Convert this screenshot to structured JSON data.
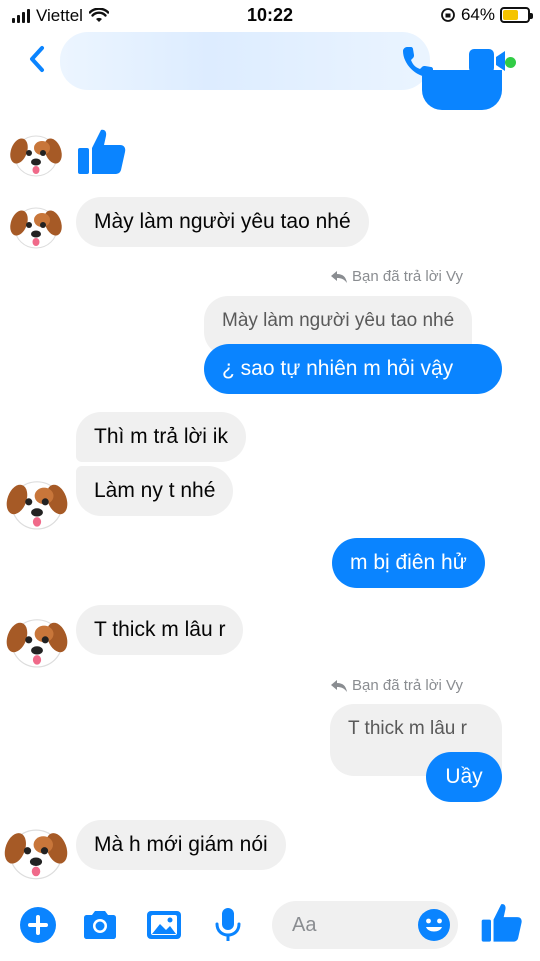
{
  "status_bar": {
    "carrier": "Viettel",
    "time": "10:22",
    "battery": "64%",
    "battery_level": 0.64
  },
  "header": {
    "back_icon": "chevron-left-icon",
    "call_icon": "phone-icon",
    "video_icon": "video-camera-icon"
  },
  "messages": [
    {
      "type": "in",
      "text": "Mày làm người yêu tao nhé"
    },
    {
      "type": "reply_label",
      "text": "Bạn đã trả lời Vy"
    },
    {
      "type": "quote",
      "text": "Mày làm người yêu tao nhé"
    },
    {
      "type": "out",
      "text": "¿ sao tự nhiên m hỏi vậy"
    },
    {
      "type": "in",
      "text": "Thì m trả lời ik"
    },
    {
      "type": "in",
      "text": "Làm ny t nhé"
    },
    {
      "type": "out",
      "text": "m bị điên hử"
    },
    {
      "type": "in",
      "text": "T thick m lâu r"
    },
    {
      "type": "reply_label",
      "text": "Bạn đã trả lời Vy"
    },
    {
      "type": "quote",
      "text": "T thick m lâu r"
    },
    {
      "type": "out",
      "text": "Uầy"
    },
    {
      "type": "in",
      "text": "Mà h mới giám nói"
    }
  ],
  "composer": {
    "placeholder": "Aa"
  },
  "colors": {
    "accent": "#0a84ff",
    "incoming_bg": "#f0f0f0",
    "active": "#31cc46"
  }
}
